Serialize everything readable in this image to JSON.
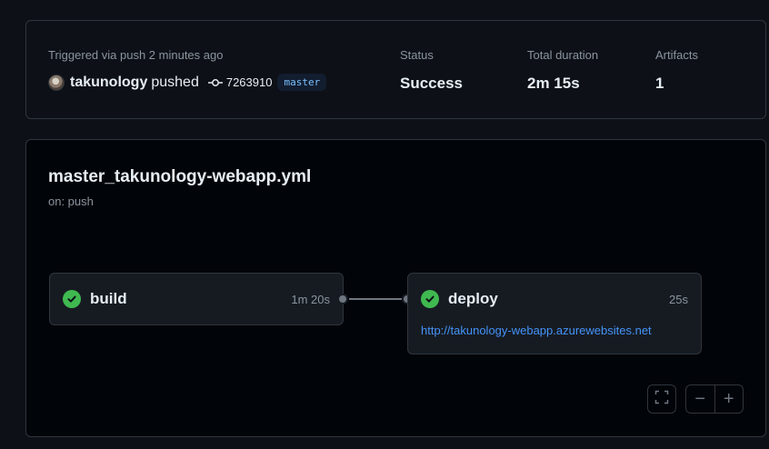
{
  "summary": {
    "trigger_text": "Triggered via push 2 minutes ago",
    "actor": "takunology",
    "action": "pushed",
    "commit_sha": "7263910",
    "branch": "master",
    "status_label": "Status",
    "status_value": "Success",
    "duration_label": "Total duration",
    "duration_value": "2m 15s",
    "artifacts_label": "Artifacts",
    "artifacts_value": "1"
  },
  "workflow": {
    "file_name": "master_takunology-webapp.yml",
    "trigger": "on: push"
  },
  "jobs": {
    "build": {
      "name": "build",
      "duration": "1m 20s",
      "status": "success"
    },
    "deploy": {
      "name": "deploy",
      "duration": "25s",
      "status": "success",
      "url": "http://takunology-webapp.azurewebsites.net"
    }
  },
  "icons": {
    "avatar": "avatar",
    "commit": "git-commit-icon",
    "check": "check-circle-icon",
    "fullscreen": "fullscreen-icon",
    "zoom_out": "minus-icon",
    "zoom_in": "plus-icon"
  },
  "colors": {
    "background": "#0d1117",
    "graph_background": "#010409",
    "success": "#3fb950",
    "link": "#4493f8",
    "branch_badge_text": "#79c0ff"
  },
  "controls": {
    "zoom_out_symbol": "−",
    "zoom_in_symbol": "+"
  }
}
